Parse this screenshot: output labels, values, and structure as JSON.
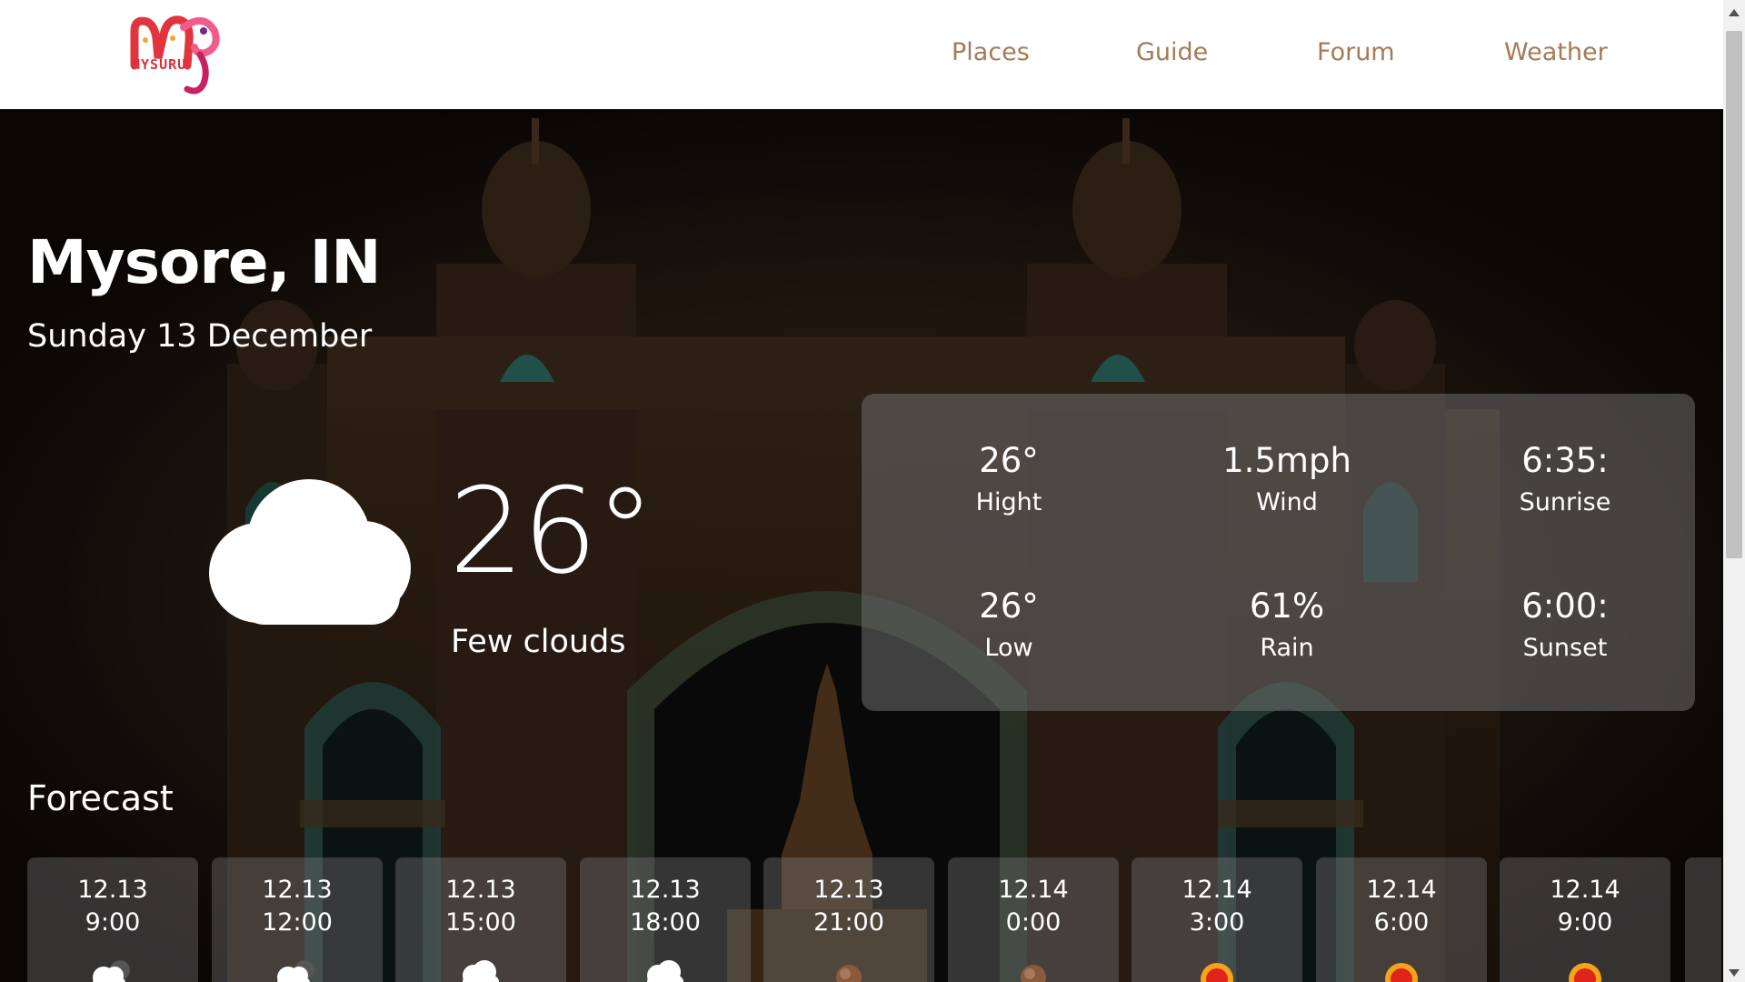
{
  "header": {
    "logo_text": "MYSURU",
    "nav": [
      {
        "label": "Places"
      },
      {
        "label": "Guide"
      },
      {
        "label": "Forum"
      },
      {
        "label": "Weather"
      }
    ]
  },
  "weather": {
    "city": "Mysore, IN",
    "date": "Sunday 13 December",
    "temperature": "26°",
    "condition": "Few clouds",
    "condition_icon": "cloud-icon",
    "stats": [
      {
        "value": "26°",
        "label": "Hight"
      },
      {
        "value": "1.5mph",
        "label": "Wind"
      },
      {
        "value": "6:35:",
        "label": "Sunrise"
      },
      {
        "value": "26°",
        "label": "Low"
      },
      {
        "value": "61%",
        "label": "Rain"
      },
      {
        "value": "6:00:",
        "label": "Sunset"
      }
    ]
  },
  "forecast": {
    "title": "Forecast",
    "items": [
      {
        "date": "12.13",
        "time": "9:00",
        "icon": "partly-cloudy-icon"
      },
      {
        "date": "12.13",
        "time": "12:00",
        "icon": "partly-cloudy-icon"
      },
      {
        "date": "12.13",
        "time": "15:00",
        "icon": "cloud-icon"
      },
      {
        "date": "12.13",
        "time": "18:00",
        "icon": "cloud-icon"
      },
      {
        "date": "12.13",
        "time": "21:00",
        "icon": "moon-icon"
      },
      {
        "date": "12.14",
        "time": "0:00",
        "icon": "moon-icon"
      },
      {
        "date": "12.14",
        "time": "3:00",
        "icon": "sun-icon"
      },
      {
        "date": "12.14",
        "time": "6:00",
        "icon": "sun-icon"
      },
      {
        "date": "12.14",
        "time": "9:00",
        "icon": "sun-icon"
      }
    ]
  }
}
